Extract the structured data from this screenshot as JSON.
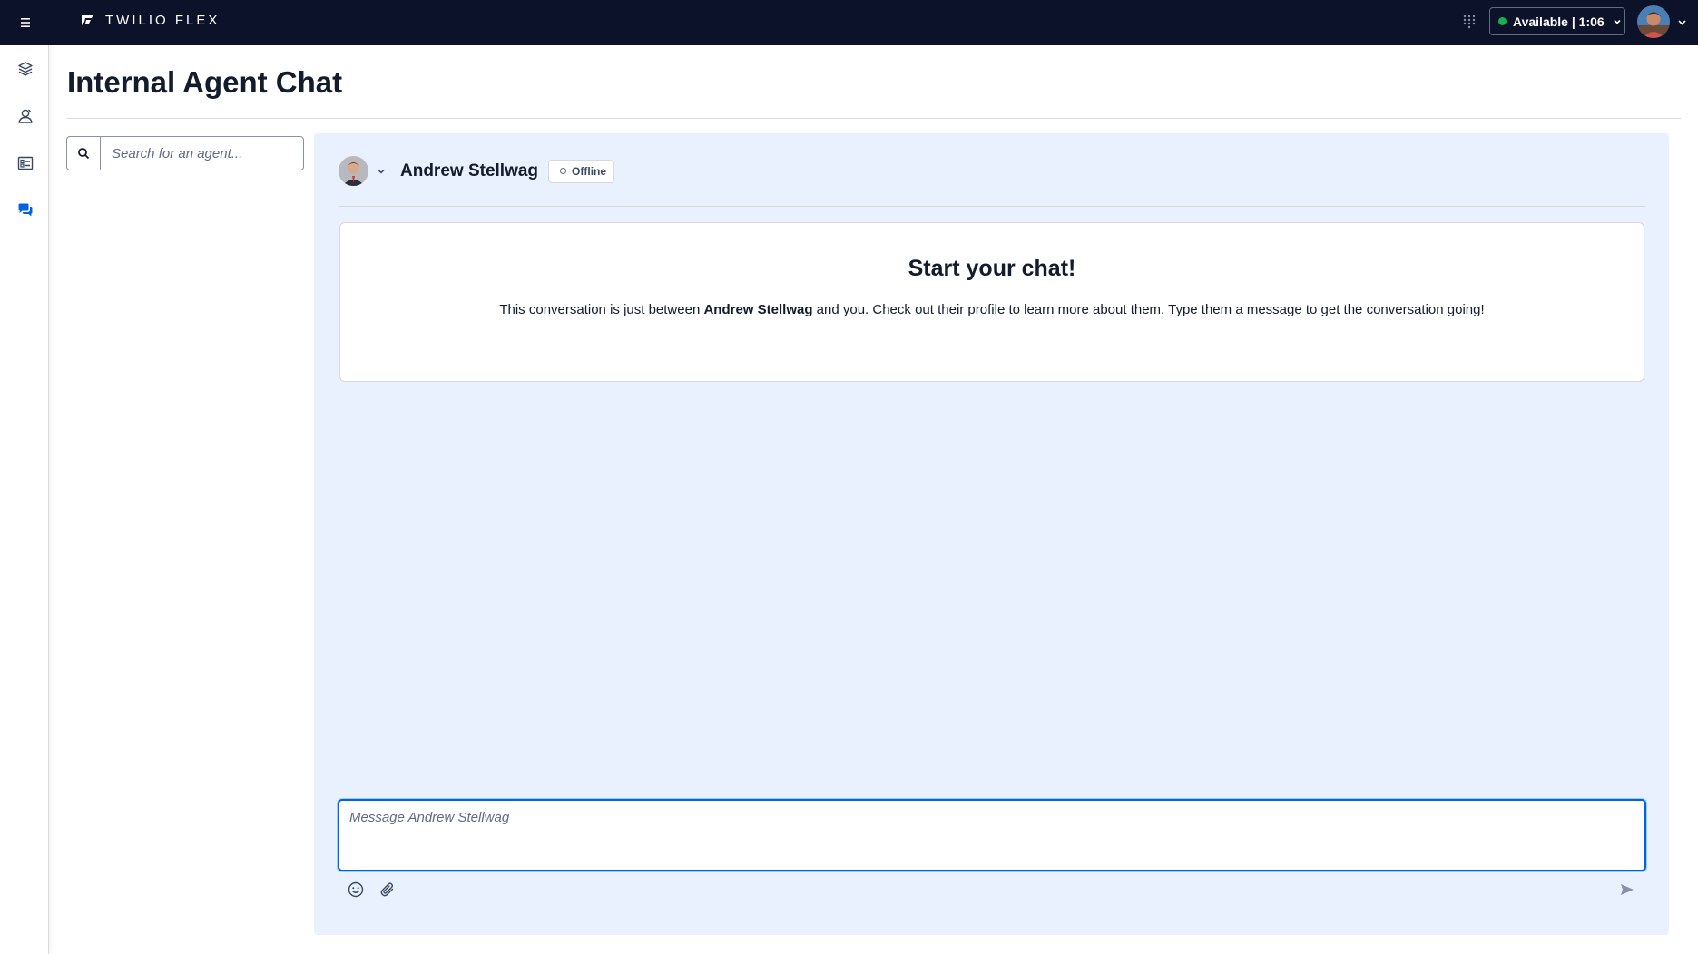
{
  "topbar": {
    "brand": "TWILIO FLEX",
    "status_label": "Available | 1:06",
    "status_color": "#14b053",
    "bg_color": "#0d122b"
  },
  "sidenav": {
    "items": [
      {
        "icon": "layers-icon",
        "label": "Agent Desktop"
      },
      {
        "icon": "teams-icon",
        "label": "Teams"
      },
      {
        "icon": "queues-stats-icon",
        "label": "Queues Stats"
      },
      {
        "icon": "chat-bubbles-icon",
        "label": "Internal Agent Chat",
        "active": true
      }
    ]
  },
  "page": {
    "title": "Internal Agent Chat"
  },
  "search": {
    "placeholder": "Search for an agent..."
  },
  "chat": {
    "contact_name": "Andrew Stellwag",
    "presence": "Offline",
    "intro_title": "Start your chat!",
    "intro_prefix": "This conversation is just between ",
    "intro_name": "Andrew Stellwag",
    "intro_suffix": " and you. Check out their profile to learn more about them. Type them a message to get the conversation going!",
    "composer_placeholder": "Message Andrew Stellwag",
    "panel_color": "#e8f1fd",
    "accent": "#0263e0"
  }
}
